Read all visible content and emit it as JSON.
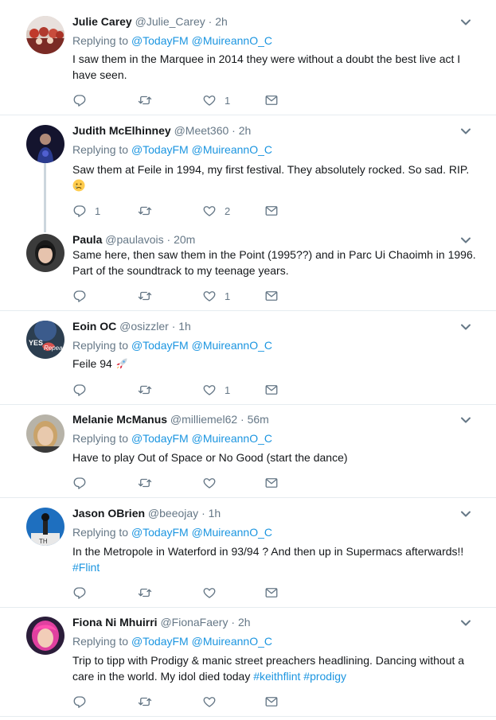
{
  "tweets": [
    {
      "name": "Julie Carey",
      "handle": "@Julie_Carey",
      "time": "2h",
      "replying_label": "Replying to",
      "replying_to": [
        "@TodayFM",
        "@MuireannO_C"
      ],
      "text_parts": [
        {
          "t": "I saw them in the Marquee in 2014 they were without a doubt the best live act I have seen."
        }
      ],
      "reply_count": "",
      "retweet_count": "",
      "like_count": "1"
    },
    {
      "name": "Judith McElhinney",
      "handle": "@Meet360",
      "time": "2h",
      "replying_label": "Replying to",
      "replying_to": [
        "@TodayFM",
        "@MuireannO_C"
      ],
      "text_parts": [
        {
          "t": "Saw them at Feile in 1994, my first festival. They absolutely rocked. So sad. RIP."
        }
      ],
      "emoji": "crying-face",
      "reply_count": "1",
      "retweet_count": "",
      "like_count": "2"
    },
    {
      "name": "Paula",
      "handle": "@paulavois",
      "time": "20m",
      "text_parts": [
        {
          "t": "Same here, then saw them in the Point (1995??) and in Parc Ui Chaoimh in 1996. Part of the soundtrack to my teenage years."
        }
      ],
      "reply_count": "",
      "retweet_count": "",
      "like_count": "1"
    },
    {
      "name": "Eoin OC",
      "handle": "@osizzler",
      "time": "1h",
      "replying_label": "Replying to",
      "replying_to": [
        "@TodayFM",
        "@MuireannO_C"
      ],
      "text_parts": [
        {
          "t": "Feile 94 "
        }
      ],
      "emoji": "rocket",
      "avatar_text": [
        "YES",
        "Repeal"
      ],
      "reply_count": "",
      "retweet_count": "",
      "like_count": "1"
    },
    {
      "name": "Melanie McManus",
      "handle": "@milliemel62",
      "time": "56m",
      "replying_label": "Replying to",
      "replying_to": [
        "@TodayFM",
        "@MuireannO_C"
      ],
      "text_parts": [
        {
          "t": "Have to play Out of Space or No Good (start the dance)"
        }
      ],
      "reply_count": "",
      "retweet_count": "",
      "like_count": ""
    },
    {
      "name": "Jason OBrien",
      "handle": "@beeojay",
      "time": "1h",
      "replying_label": "Replying to",
      "replying_to": [
        "@TodayFM",
        "@MuireannO_C"
      ],
      "text_parts": [
        {
          "t": "In the Metropole in Waterford in 93/94 ? And then up in Supermacs afterwards!! "
        },
        {
          "t": "#Flint",
          "tag": true
        }
      ],
      "reply_count": "",
      "retweet_count": "",
      "like_count": ""
    },
    {
      "name": "Fiona Ni Mhuirri",
      "handle": "@FionaFaery",
      "time": "2h",
      "replying_label": "Replying to",
      "replying_to": [
        "@TodayFM",
        "@MuireannO_C"
      ],
      "text_parts": [
        {
          "t": "Trip to tipp with Prodigy & manic street preachers headlining. Dancing without a care in the world. My idol died today "
        },
        {
          "t": "#keithflint",
          "tag": true
        },
        {
          "t": " "
        },
        {
          "t": "#prodigy",
          "tag": true
        }
      ],
      "reply_count": "",
      "retweet_count": "",
      "like_count": ""
    }
  ],
  "ui": {
    "dot": "·",
    "icons": {
      "reply": "reply-icon",
      "retweet": "retweet-icon",
      "like": "heart-icon",
      "dm": "envelope-icon",
      "menu": "chevron-down-icon"
    },
    "colors": {
      "link": "#1b95e0",
      "muted": "#657786",
      "text": "#14171a",
      "divider": "#e6ecf0",
      "thread": "#ccd6dd"
    }
  }
}
